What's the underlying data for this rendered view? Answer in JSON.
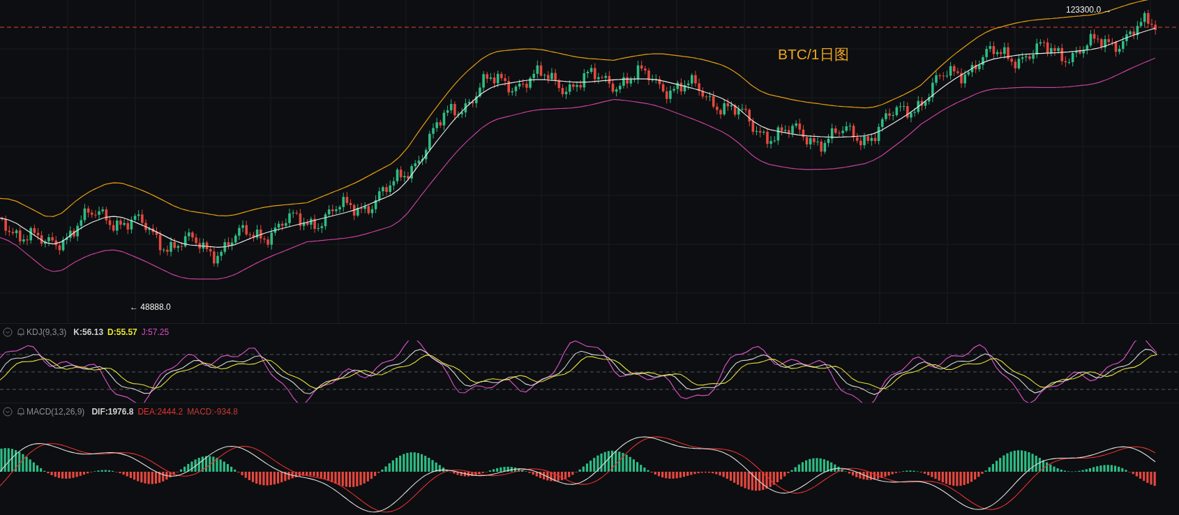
{
  "main_chart": {
    "title": "BTC/1日图",
    "high_label": "123300.0 →",
    "low_label": "← 48888.0"
  },
  "kdj": {
    "name": "KDJ(9,3,3)",
    "k": "K:56.13",
    "d": "D:55.57",
    "j": "J:57.25"
  },
  "macd": {
    "name": "MACD(12,26,9)",
    "dif": "DIF:1976.8",
    "dea": "DEA:2444.2",
    "macd": "MACD:-934.8"
  }
}
